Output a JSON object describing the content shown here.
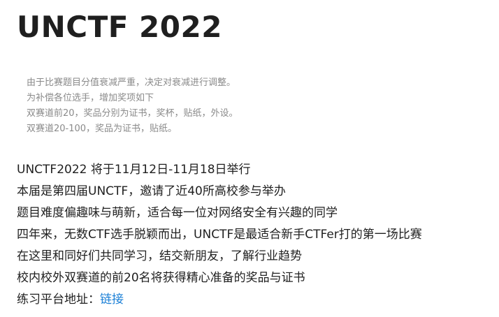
{
  "page": {
    "title": "UNCTF 2022"
  },
  "notice": {
    "lines": [
      "由于比赛题目分值衰减严重，决定对衰减进行调整。",
      "为补偿各位选手，增加奖项如下",
      "双赛道前20，奖品分别为证书，奖杯，贴纸，外设。",
      "双赛道20-100，奖品为证书，贴纸。"
    ]
  },
  "intro": {
    "lines": [
      "UNCTF2022 将于11月12日-11月18日举行",
      "本届是第四届UNCTF，邀请了近40所高校参与举办",
      "题目难度偏趣味与萌新，适合每一位对网络安全有兴趣的同学",
      "四年来，无数CTF选手脱颖而出，UNCTF是最适合新手CTFer打的第一场比赛",
      "在这里和同好们共同学习，结交新朋友，了解行业趋势",
      "校内校外双赛道的前20名将获得精心准备的奖品与证书"
    ],
    "platform_label": "练习平台地址：",
    "platform_link_text": "链接"
  },
  "colors": {
    "text": "#1f1f1f",
    "notice_text": "#8a8a8a",
    "link": "#1a7fd6",
    "background": "#ffffff"
  }
}
